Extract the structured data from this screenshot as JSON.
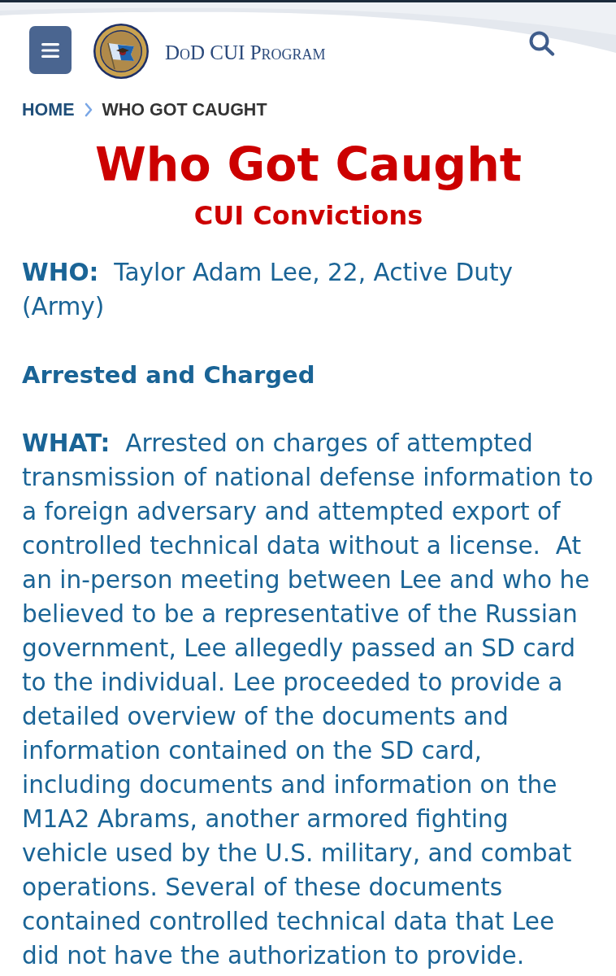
{
  "header": {
    "site_title": "DoD CUI Program"
  },
  "breadcrumb": [
    {
      "label": "HOME",
      "current": false
    },
    {
      "label": "WHO GOT CAUGHT",
      "current": true
    }
  ],
  "title": "Who Got Caught",
  "subtitle": "CUI Convictions",
  "sections": [
    {
      "kind": "field",
      "text": "**WHO:**  Taylor Adam Lee, 22, Active Duty (Army)"
    },
    {
      "kind": "heading",
      "text": "Arrested and Charged"
    },
    {
      "kind": "field",
      "text": "**WHAT:**  Arrested on charges of attempted transmission of national defense information to a foreign adversary and attempted export of controlled technical data without a license.  At an in-person meeting between Lee and who he believed to be a representative of the Russian government, Lee allegedly passed an SD card to the individual. Lee proceeded to provide a detailed overview of the documents and information contained on the SD card, including documents and information on the M1A2 Abrams, another armored fighting vehicle used by the U.S. military, and combat operations. Several of these documents contained controlled technical data that Lee did not have the authorization to provide."
    }
  ]
}
